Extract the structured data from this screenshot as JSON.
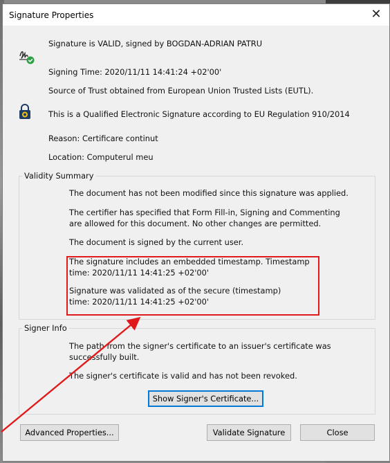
{
  "dialog": {
    "title": "Signature Properties"
  },
  "header": {
    "status_text": "Signature is VALID, signed by BOGDAN-ADRIAN PATRU",
    "signing_time": "Signing Time:  2020/11/11 14:41:24 +02'00'",
    "trust_source": "Source of Trust obtained from European Union Trusted Lists (EUTL).",
    "qualified_text": "This is a Qualified Electronic Signature according to EU Regulation 910/2014",
    "reason": "Reason:  Certificare continut",
    "location": "Location:  Computerul meu"
  },
  "validity": {
    "title": "Validity Summary",
    "items": [
      "The document has not been modified since this signature was applied.",
      "The certifier has specified that Form Fill-in, Signing and Commenting are allowed for this document. No other changes are permitted.",
      "The document is signed by the current user.",
      "The signature includes an embedded timestamp. Timestamp time: 2020/11/11 14:41:25 +02'00'",
      "Signature was validated as of the secure (timestamp) time: 2020/11/11 14:41:25 +02'00'"
    ]
  },
  "signer": {
    "title": "Signer Info",
    "items": [
      "The path from the signer's certificate to an issuer's certificate was successfully built.",
      "The signer's certificate is valid and has not been revoked."
    ],
    "show_cert_label": "Show Signer's Certificate..."
  },
  "buttons": {
    "advanced": "Advanced Properties...",
    "validate": "Validate Signature",
    "close": "Close"
  },
  "icons": {
    "signature_valid": "signature-valid-icon",
    "qualified_lock": "lock-shield-icon",
    "close": "close-icon"
  },
  "colors": {
    "highlight": "#e0191b",
    "valid_check": "#2ea043",
    "focus": "#0078d7"
  }
}
